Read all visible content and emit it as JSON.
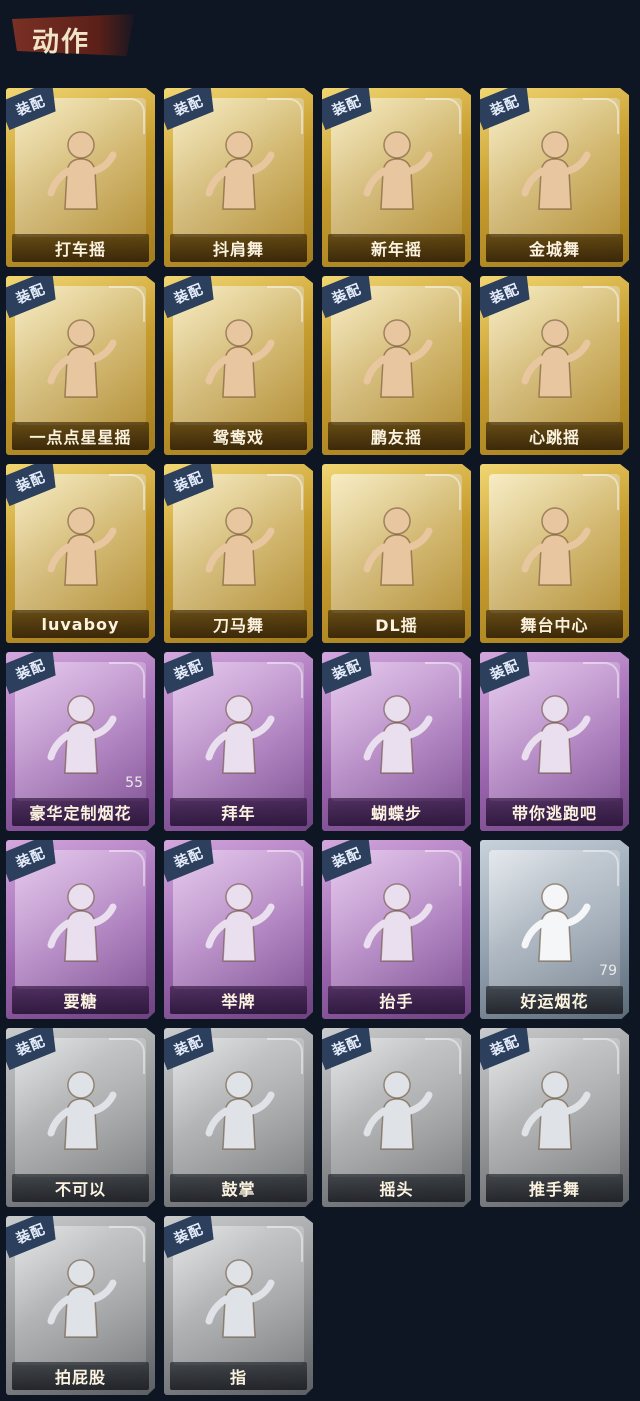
{
  "section_title": "动作",
  "colors": {
    "gold": "#c79d2f",
    "purple": "#9a64ad",
    "blue": "#8e9cab",
    "gray": "#8f9193",
    "badge": "#2c3f5c"
  },
  "items": [
    {
      "label": "打车摇",
      "rarity": "gold",
      "badge": "装配",
      "icon": "dance-pose-icon"
    },
    {
      "label": "抖肩舞",
      "rarity": "gold",
      "badge": "装配",
      "icon": "dance-pose-icon"
    },
    {
      "label": "新年摇",
      "rarity": "gold",
      "badge": "装配",
      "icon": "dance-pose-icon"
    },
    {
      "label": "金城舞",
      "rarity": "gold",
      "badge": "装配",
      "icon": "dance-pose-icon"
    },
    {
      "label": "一点点星星摇",
      "rarity": "gold",
      "badge": "装配",
      "icon": "dance-pose-icon"
    },
    {
      "label": "鸳鸯戏",
      "rarity": "gold",
      "badge": "装配",
      "icon": "dance-pose-icon"
    },
    {
      "label": "鹏友摇",
      "rarity": "gold",
      "badge": "装配",
      "icon": "dance-pose-icon"
    },
    {
      "label": "心跳摇",
      "rarity": "gold",
      "badge": "装配",
      "icon": "dance-pose-icon"
    },
    {
      "label": "luvaboy",
      "rarity": "gold",
      "badge": "装配",
      "icon": "dance-pose-icon"
    },
    {
      "label": "刀马舞",
      "rarity": "gold",
      "badge": "装配",
      "icon": "dance-pose-icon"
    },
    {
      "label": "DL摇",
      "rarity": "gold",
      "badge": "",
      "icon": "dance-pose-icon"
    },
    {
      "label": "舞台中心",
      "rarity": "gold",
      "badge": "",
      "icon": "dance-pose-icon"
    },
    {
      "label": "豪华定制烟花",
      "rarity": "purple",
      "badge": "装配",
      "icon": "fireworks-box-icon",
      "count": "55"
    },
    {
      "label": "拜年",
      "rarity": "purple",
      "badge": "装配",
      "icon": "bow-pose-icon"
    },
    {
      "label": "蝴蝶步",
      "rarity": "purple",
      "badge": "装配",
      "icon": "dance-pose-icon"
    },
    {
      "label": "带你逃跑吧",
      "rarity": "purple",
      "badge": "装配",
      "icon": "dance-pose-icon"
    },
    {
      "label": "要糖",
      "rarity": "purple",
      "badge": "装配",
      "icon": "reach-pose-icon"
    },
    {
      "label": "举牌",
      "rarity": "purple",
      "badge": "装配",
      "icon": "sign-pose-icon"
    },
    {
      "label": "抬手",
      "rarity": "purple",
      "badge": "装配",
      "icon": "raise-hand-icon"
    },
    {
      "label": "好运烟花",
      "rarity": "blue",
      "badge": "",
      "icon": "firework-can-icon",
      "count": "79"
    },
    {
      "label": "不可以",
      "rarity": "gray",
      "badge": "装配",
      "icon": "finger-wag-icon"
    },
    {
      "label": "鼓掌",
      "rarity": "gray",
      "badge": "装配",
      "icon": "clap-icon"
    },
    {
      "label": "摇头",
      "rarity": "gray",
      "badge": "装配",
      "icon": "shake-head-icon"
    },
    {
      "label": "推手舞",
      "rarity": "gray",
      "badge": "装配",
      "icon": "push-dance-icon"
    },
    {
      "label": "拍屁股",
      "rarity": "gray",
      "badge": "装配",
      "icon": "pat-pose-icon"
    },
    {
      "label": "指",
      "rarity": "gray",
      "badge": "装配",
      "icon": "point-icon"
    }
  ]
}
